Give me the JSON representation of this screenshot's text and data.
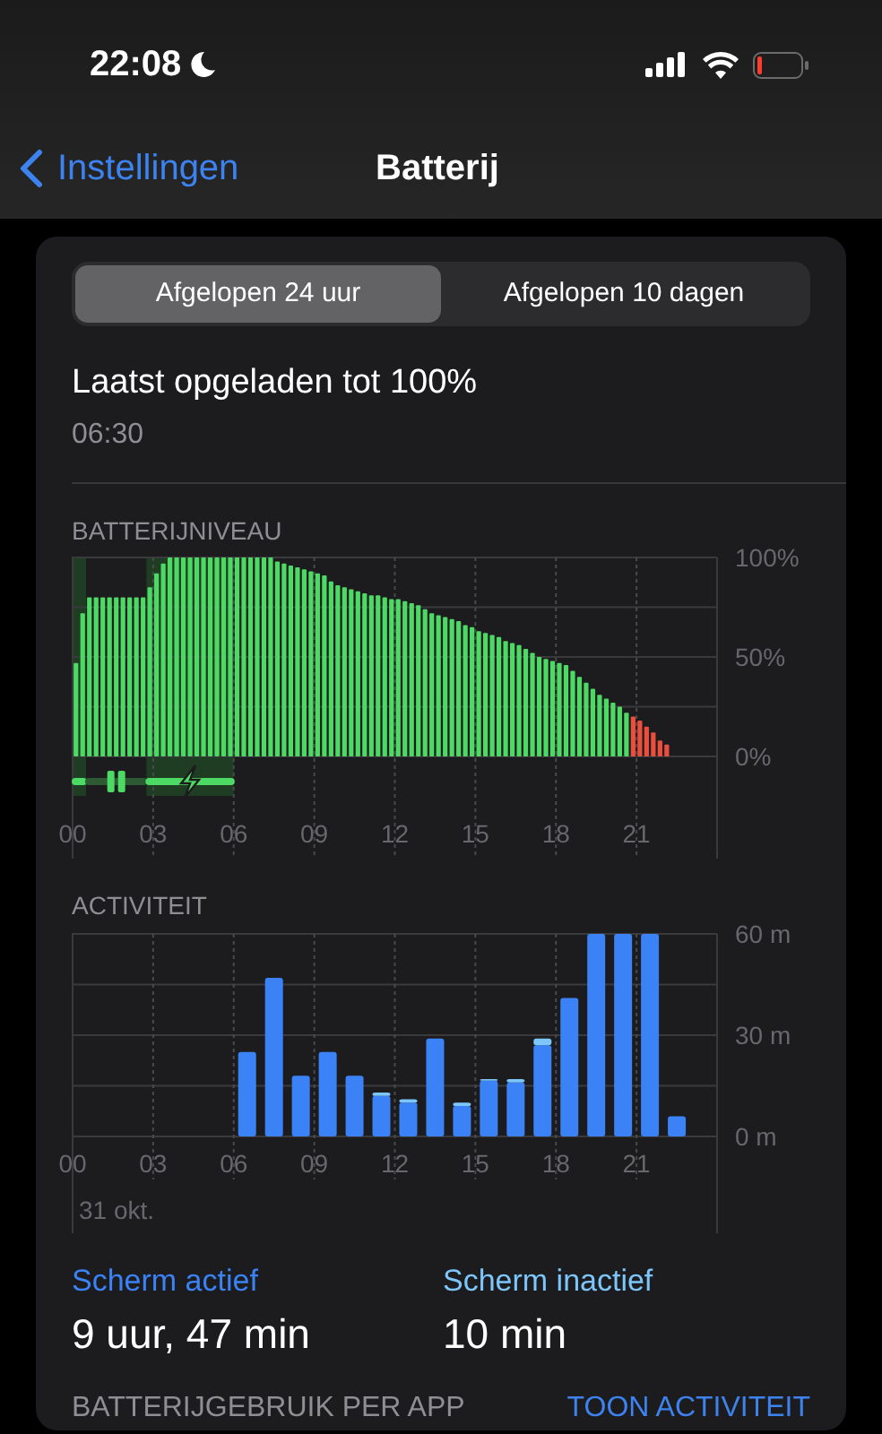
{
  "status_bar": {
    "time": "22:08",
    "do_not_disturb": true,
    "battery_low": true
  },
  "nav": {
    "back_label": "Instellingen",
    "title": "Batterij"
  },
  "segments": [
    {
      "label": "Afgelopen 24 uur",
      "selected": true
    },
    {
      "label": "Afgelopen 10 dagen",
      "selected": false
    }
  ],
  "last_charged": {
    "title": "Laatst opgeladen tot 100%",
    "time": "06:30"
  },
  "battery_level": {
    "heading": "BATTERIJNIVEAU",
    "chart_data": {
      "type": "bar",
      "x": [
        0.125,
        0.375,
        0.625,
        0.875,
        1.125,
        1.375,
        1.625,
        1.875,
        2.125,
        2.375,
        2.625,
        2.875,
        3.125,
        3.375,
        3.625,
        3.875,
        4.125,
        4.375,
        4.625,
        4.875,
        5.125,
        5.375,
        5.625,
        5.875,
        6.125,
        6.375,
        6.625,
        6.875,
        7.125,
        7.375,
        7.625,
        7.875,
        8.125,
        8.375,
        8.625,
        8.875,
        9.125,
        9.375,
        9.625,
        9.875,
        10.125,
        10.375,
        10.625,
        10.875,
        11.125,
        11.375,
        11.625,
        11.875,
        12.125,
        12.375,
        12.625,
        12.875,
        13.125,
        13.375,
        13.625,
        13.875,
        14.125,
        14.375,
        14.625,
        14.875,
        15.125,
        15.375,
        15.625,
        15.875,
        16.125,
        16.375,
        16.625,
        16.875,
        17.125,
        17.375,
        17.625,
        17.875,
        18.125,
        18.375,
        18.625,
        18.875,
        19.125,
        19.375,
        19.625,
        19.875,
        20.125,
        20.375,
        20.625,
        20.875,
        21.125,
        21.375,
        21.625,
        21.875,
        22.125
      ],
      "series": [
        {
          "color": "#4cd964",
          "values": [
            47,
            72,
            80,
            80,
            80,
            80,
            80,
            80,
            80,
            80,
            80,
            85,
            92,
            97,
            100,
            100,
            100,
            100,
            100,
            100,
            100,
            100,
            100,
            100,
            100,
            100,
            100,
            100,
            100,
            100,
            98,
            97,
            96,
            95,
            94,
            93,
            92,
            91,
            88,
            86,
            85,
            84,
            83,
            82,
            81,
            81,
            80,
            79,
            79,
            78,
            77,
            76,
            74,
            72,
            71,
            70,
            69,
            68,
            66,
            65,
            63,
            62,
            61,
            60,
            58,
            57,
            56,
            54,
            52,
            50,
            49,
            48,
            47,
            46,
            43,
            40,
            37,
            34,
            31,
            29,
            27,
            25,
            22,
            null,
            null,
            null,
            null,
            null,
            null
          ]
        },
        {
          "color": "#eb4e3d",
          "values": [
            null,
            null,
            null,
            null,
            null,
            null,
            null,
            null,
            null,
            null,
            null,
            null,
            null,
            null,
            null,
            null,
            null,
            null,
            null,
            null,
            null,
            null,
            null,
            null,
            null,
            null,
            null,
            null,
            null,
            null,
            null,
            null,
            null,
            null,
            null,
            null,
            null,
            null,
            null,
            null,
            null,
            null,
            null,
            null,
            null,
            null,
            null,
            null,
            null,
            null,
            null,
            null,
            null,
            null,
            null,
            null,
            null,
            null,
            null,
            null,
            null,
            null,
            null,
            null,
            null,
            null,
            null,
            null,
            null,
            null,
            null,
            null,
            null,
            null,
            null,
            null,
            null,
            null,
            null,
            null,
            null,
            null,
            null,
            20,
            18,
            15,
            12,
            8,
            6
          ]
        }
      ],
      "xlim": [
        0,
        24
      ],
      "ylim": [
        0,
        100
      ],
      "xticks": [
        {
          "value": 0,
          "label": "00"
        },
        {
          "value": 3,
          "label": "03"
        },
        {
          "value": 6,
          "label": "06"
        },
        {
          "value": 9,
          "label": "09"
        },
        {
          "value": 12,
          "label": "12"
        },
        {
          "value": 15,
          "label": "15"
        },
        {
          "value": 18,
          "label": "18"
        },
        {
          "value": 21,
          "label": "21"
        }
      ],
      "yticks": [
        {
          "value": 0,
          "label": "0%"
        },
        {
          "value": 50,
          "label": "50%"
        },
        {
          "value": 100,
          "label": "100%"
        }
      ],
      "grid": true,
      "bands": [
        {
          "axis": "x",
          "from": 0,
          "to": 0.5
        },
        {
          "axis": "x",
          "from": 2.75,
          "to": 6
        }
      ]
    }
  },
  "activity": {
    "heading": "ACTIVITEIT",
    "chart_data": {
      "type": "bar",
      "stacked": true,
      "x": [
        6.5,
        7.5,
        8.5,
        9.5,
        10.5,
        11.5,
        12.5,
        13.5,
        14.5,
        15.5,
        16.5,
        17.5,
        18.5,
        19.5,
        20.5,
        21.5,
        22.5
      ],
      "series": [
        {
          "name": "Scherm actief",
          "color": "#3b82f6",
          "values": [
            25,
            47,
            18,
            25,
            18,
            12,
            10,
            29,
            9,
            16.5,
            16,
            27,
            41,
            60,
            60,
            60,
            6
          ]
        },
        {
          "name": "Scherm inactief",
          "color": "#7cc6fb",
          "values": [
            0,
            0,
            0,
            0,
            0,
            1,
            1,
            0,
            1,
            0.5,
            1,
            2,
            0,
            0,
            0,
            0,
            0
          ]
        }
      ],
      "xlim": [
        0,
        24
      ],
      "ylim": [
        0,
        60
      ],
      "xticks": [
        {
          "value": 0,
          "label": "00"
        },
        {
          "value": 3,
          "label": "03"
        },
        {
          "value": 6,
          "label": "06"
        },
        {
          "value": 9,
          "label": "09"
        },
        {
          "value": 12,
          "label": "12"
        },
        {
          "value": 15,
          "label": "15"
        },
        {
          "value": 18,
          "label": "18"
        },
        {
          "value": 21,
          "label": "21"
        }
      ],
      "yticks": [
        {
          "value": 0,
          "label": "0 m"
        },
        {
          "value": 30,
          "label": "30 m"
        },
        {
          "value": 60,
          "label": "60 m"
        }
      ],
      "grid": true
    },
    "date_label": "31 okt."
  },
  "summary": [
    {
      "value": "9 uur, 47 min"
    },
    {
      "value": "10 min"
    }
  ],
  "footer": {
    "heading": "BATTERIJGEBRUIK PER APP",
    "action": "TOON ACTIVITEIT"
  }
}
